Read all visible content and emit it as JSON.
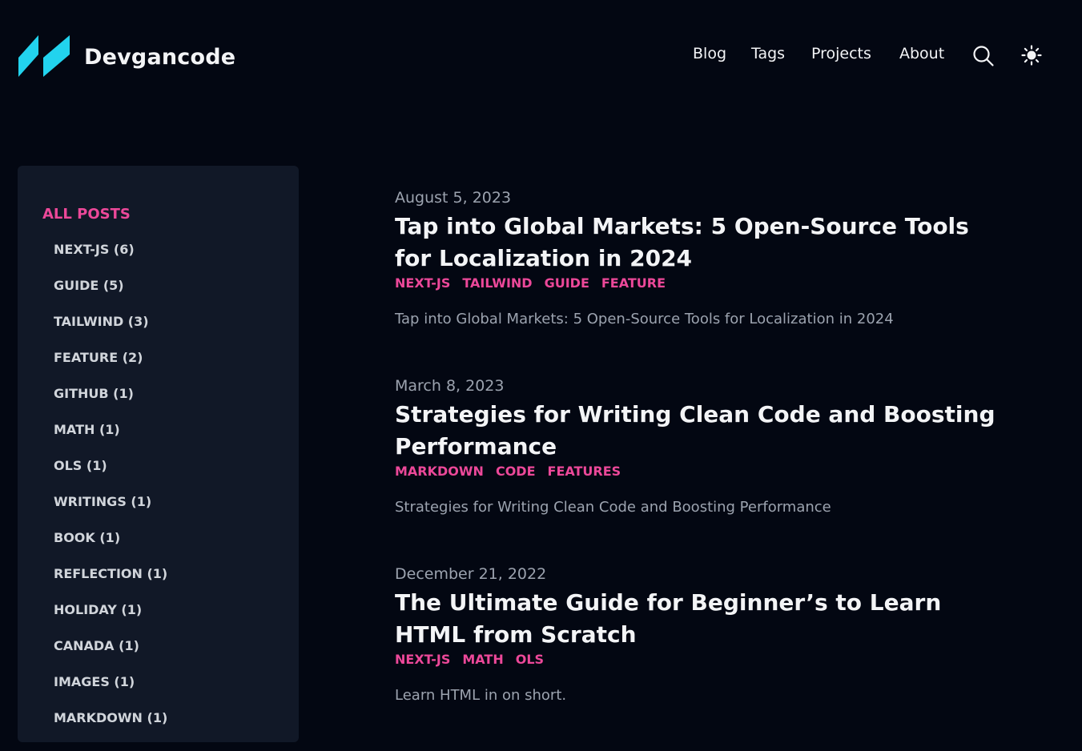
{
  "header": {
    "site_title": "Devgancode",
    "logo_icon": "slashes-logo-icon",
    "nav": [
      {
        "label": "Blog"
      },
      {
        "label": "Tags"
      },
      {
        "label": "Projects"
      },
      {
        "label": "About"
      }
    ],
    "search_icon": "search-icon",
    "theme_icon": "sun-icon"
  },
  "colors": {
    "background": "#030712",
    "sidebar_bg": "#111827",
    "accent": "#ec4899",
    "logo": "#22d3ee"
  },
  "sidebar": {
    "title": "ALL POSTS",
    "tags": [
      {
        "label": "NEXT-JS (6)"
      },
      {
        "label": "GUIDE (5)"
      },
      {
        "label": "TAILWIND (3)"
      },
      {
        "label": "FEATURE (2)"
      },
      {
        "label": "GITHUB (1)"
      },
      {
        "label": "MATH (1)"
      },
      {
        "label": "OLS (1)"
      },
      {
        "label": "WRITINGS (1)"
      },
      {
        "label": "BOOK (1)"
      },
      {
        "label": "REFLECTION (1)"
      },
      {
        "label": "HOLIDAY (1)"
      },
      {
        "label": "CANADA (1)"
      },
      {
        "label": "IMAGES (1)"
      },
      {
        "label": "MARKDOWN (1)"
      }
    ]
  },
  "posts": [
    {
      "date": "August 5, 2023",
      "title": "Tap into Global Markets: 5 Open-Source Tools for Localization in 2024",
      "tags": [
        "NEXT-JS",
        "TAILWIND",
        "GUIDE",
        "FEATURE"
      ],
      "summary": "Tap into Global Markets: 5 Open-Source Tools for Localization in 2024"
    },
    {
      "date": "March 8, 2023",
      "title": "Strategies for Writing Clean Code and Boosting Performance",
      "tags": [
        "MARKDOWN",
        "CODE",
        "FEATURES"
      ],
      "summary": "Strategies for Writing Clean Code and Boosting Performance"
    },
    {
      "date": "December 21, 2022",
      "title": "The Ultimate Guide for Beginner’s to Learn HTML from Scratch",
      "tags": [
        "NEXT-JS",
        "MATH",
        "OLS"
      ],
      "summary": "Learn HTML in on short."
    }
  ]
}
